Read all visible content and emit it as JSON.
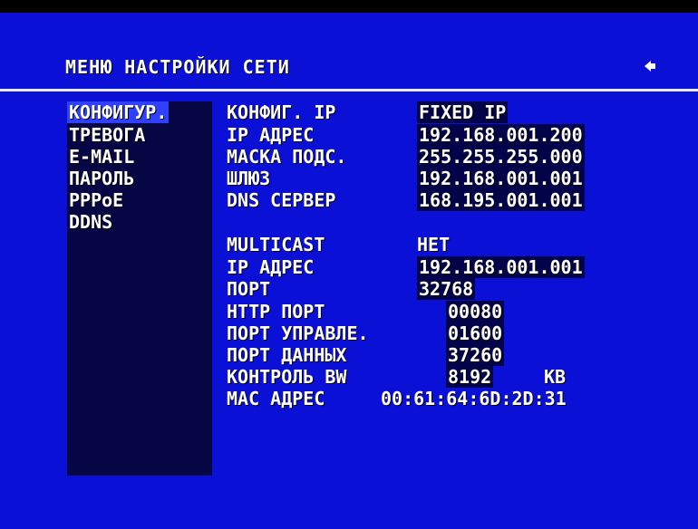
{
  "menu": {
    "title": "МЕНЮ НАСТРОЙКИ СЕТИ",
    "back_icon": "back-arrow-icon"
  },
  "sidebar": {
    "items": [
      {
        "label": "КОНФИГУР.",
        "selected": true
      },
      {
        "label": "ТРЕВОГА"
      },
      {
        "label": "E-MAIL"
      },
      {
        "label": "ПАРОЛЬ"
      },
      {
        "label": "PPPoE"
      },
      {
        "label": "DDNS"
      }
    ]
  },
  "config": {
    "ip_mode": {
      "label": "КОНФИГ. IP",
      "value": "FIXED IP"
    },
    "ip": {
      "label": "IP АДРЕС",
      "value": "192.168.001.200"
    },
    "mask": {
      "label": "МАСКА ПОДС.",
      "value": "255.255.255.000"
    },
    "gateway": {
      "label": "ШЛЮЗ",
      "value": "192.168.001.001"
    },
    "dns": {
      "label": "DNS СЕРВЕР",
      "value": "168.195.001.001"
    }
  },
  "multicast": {
    "mode": {
      "label": "MULTICAST",
      "value": "НЕТ"
    },
    "ip": {
      "label": "IP АДРЕС",
      "value": "192.168.001.001"
    },
    "port": {
      "label": "ПОРТ",
      "value": "32768"
    }
  },
  "ports": {
    "http": {
      "label": "HTTP ПОРТ",
      "value": "00080"
    },
    "control": {
      "label": "ПОРТ УПРАВЛЕ.",
      "value": "01600"
    },
    "data": {
      "label": "ПОРТ ДАННЫХ",
      "value": "37260"
    },
    "bandwidth": {
      "label": "КОНТРОЛЬ BW",
      "value": "8192",
      "unit": "KB"
    },
    "mac": {
      "label": "MAC АДРЕС",
      "value": "00:61:64:6D:2D:31"
    }
  },
  "colors": {
    "background": "#0a10d6",
    "sidebar": "#060645",
    "selected": "#3040ff",
    "value_box": "#03034a",
    "text": "#ffffff"
  }
}
